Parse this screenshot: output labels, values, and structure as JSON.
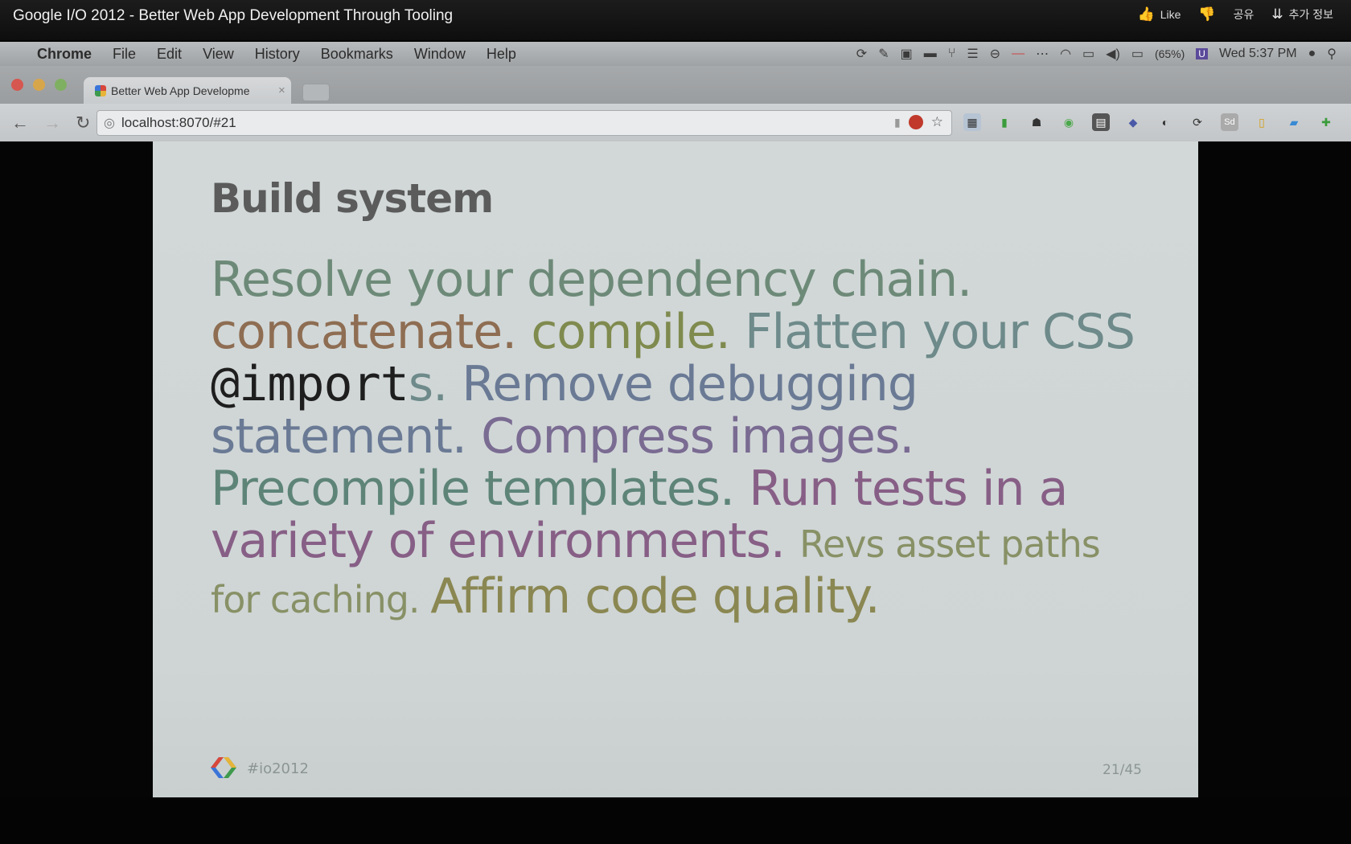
{
  "video": {
    "title": "Google I/O 2012 - Better Web App Development Through Tooling",
    "actions": [
      {
        "icon": "thumbs-up-icon",
        "label": "Like"
      },
      {
        "icon": "thumbs-down-icon",
        "label": ""
      },
      {
        "icon": "share-icon",
        "label": "공유"
      },
      {
        "icon": "more-info-icon",
        "label": "추가 정보"
      }
    ]
  },
  "menubar": {
    "app": "Chrome",
    "items": [
      "File",
      "Edit",
      "View",
      "History",
      "Bookmarks",
      "Window",
      "Help"
    ],
    "battery": "(65%)",
    "clock": "Wed 5:37 PM"
  },
  "tab": {
    "title": "Better Web App Developme",
    "close": "×"
  },
  "toolbar": {
    "url": "localhost:8070/#21"
  },
  "slide": {
    "title": "Build system",
    "segments": [
      {
        "text": "Resolve your dependency chain. ",
        "style": "c-green"
      },
      {
        "text": "concatenate. ",
        "style": "c-brown"
      },
      {
        "text": "compile. ",
        "style": "c-olive"
      },
      {
        "text": "Flatten your CSS ",
        "style": "c-teal"
      },
      {
        "text": "@import",
        "style": "c-mono"
      },
      {
        "text": "s. ",
        "style": "c-teal"
      },
      {
        "text": "Remove debugging statement. ",
        "style": "c-blue"
      },
      {
        "text": "Compress images. ",
        "style": "c-purple"
      },
      {
        "text": "Precompile templates. ",
        "style": "c-dteal"
      },
      {
        "text": "Run tests in a variety of environments. ",
        "style": "c-violet"
      },
      {
        "text": "Revs asset paths for caching. ",
        "style": "c-small"
      },
      {
        "text": "Affirm code quality.",
        "style": "c-khaki"
      }
    ],
    "hashtag": "#io2012",
    "page": "21/45"
  },
  "colors": {
    "slide_bg": "#d2d8d8",
    "menubar": "#b0b3b5"
  }
}
